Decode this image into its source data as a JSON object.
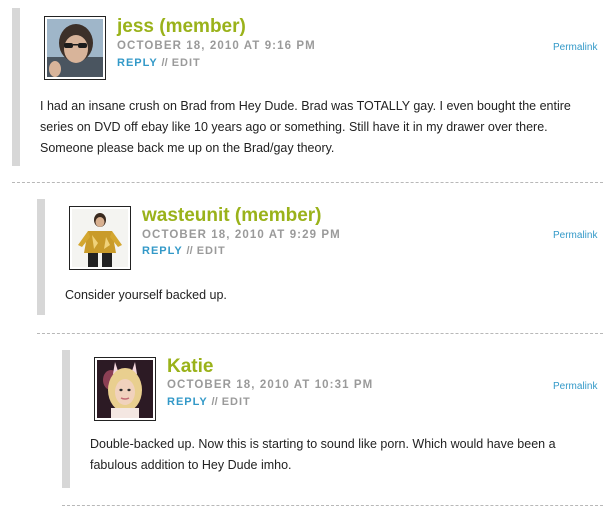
{
  "comments": [
    {
      "author": "jess (member)",
      "date": "OCTOBER 18, 2010 AT 9:16 PM",
      "reply_label": "REPLY",
      "separator": "//",
      "edit_label": "EDIT",
      "permalink_label": "Permalink",
      "body": "I had an insane crush on Brad from Hey Dude. Brad was TOTALLY gay. I even bought the entire series on DVD off ebay like 10 years ago or something. Still have it in my drawer over there. Someone please back me up on the Brad/gay theory."
    },
    {
      "author": "wasteunit (member)",
      "date": "OCTOBER 18, 2010 AT 9:29 PM",
      "reply_label": "REPLY",
      "separator": "//",
      "edit_label": "EDIT",
      "permalink_label": "Permalink",
      "body": "Consider yourself backed up."
    },
    {
      "author": "Katie",
      "date": "OCTOBER 18, 2010 AT 10:31 PM",
      "reply_label": "REPLY",
      "separator": "//",
      "edit_label": "EDIT",
      "permalink_label": "Permalink",
      "body": "Double-backed up. Now this is starting to sound like porn. Which would have been a fabulous addition to Hey Dude imho."
    }
  ],
  "colors": {
    "author": "#9ab21a",
    "link": "#3399c8",
    "meta": "#9a9a9a",
    "thread_bar": "#d7d7d7"
  }
}
